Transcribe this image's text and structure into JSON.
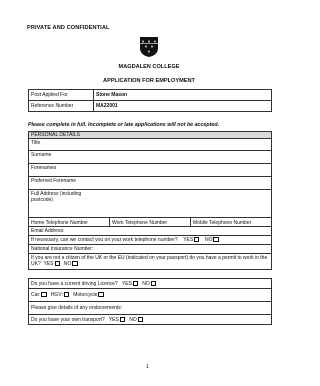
{
  "header": {
    "confidential": "PRIVATE AND CONFIDENTIAL",
    "college": "MAGDALEN COLLEGE",
    "title": "APPLICATION FOR EMPLOYMENT"
  },
  "post_table": {
    "post_label": "Post Applied For",
    "post_value": "Stone Mason",
    "ref_label": "Reference Number",
    "ref_value": "MA22001"
  },
  "note": "Please complete in full. Incomplete or late applications will not be accepted.",
  "personal": {
    "section_title": "PERSONAL DETAILS",
    "title_label": "Title",
    "surname_label": "Surname",
    "forenames_label": "Forenames",
    "preferred_label": "Preferred Forename",
    "address_label": "Full Address (including postcode)",
    "home_phone_label": "Home Telephone Number",
    "work_phone_label": "Work Telephone Number",
    "mobile_phone_label": "Mobile Telephone Number",
    "email_label": "Email Address:",
    "contact_work_question": "If necessary, can we contact you on your work telephone number?",
    "yes_label": "YES",
    "no_label": "NO",
    "ni_label": "National Insurance Number:",
    "eu_question": "If you are not a citizen of the UK or the EU (indicated on your passport) do you have a permit to work in the UK?"
  },
  "driving": {
    "licence_question": "Do you have a current driving Licence?",
    "car_label": "Car:",
    "hgv_label": "HGV:",
    "motorcycle_label": "Motorcycle",
    "endorsements_label": "Please give details of any endorsements:",
    "transport_question": "Do you have your own transport?"
  },
  "footer": {
    "page_number": "1"
  }
}
